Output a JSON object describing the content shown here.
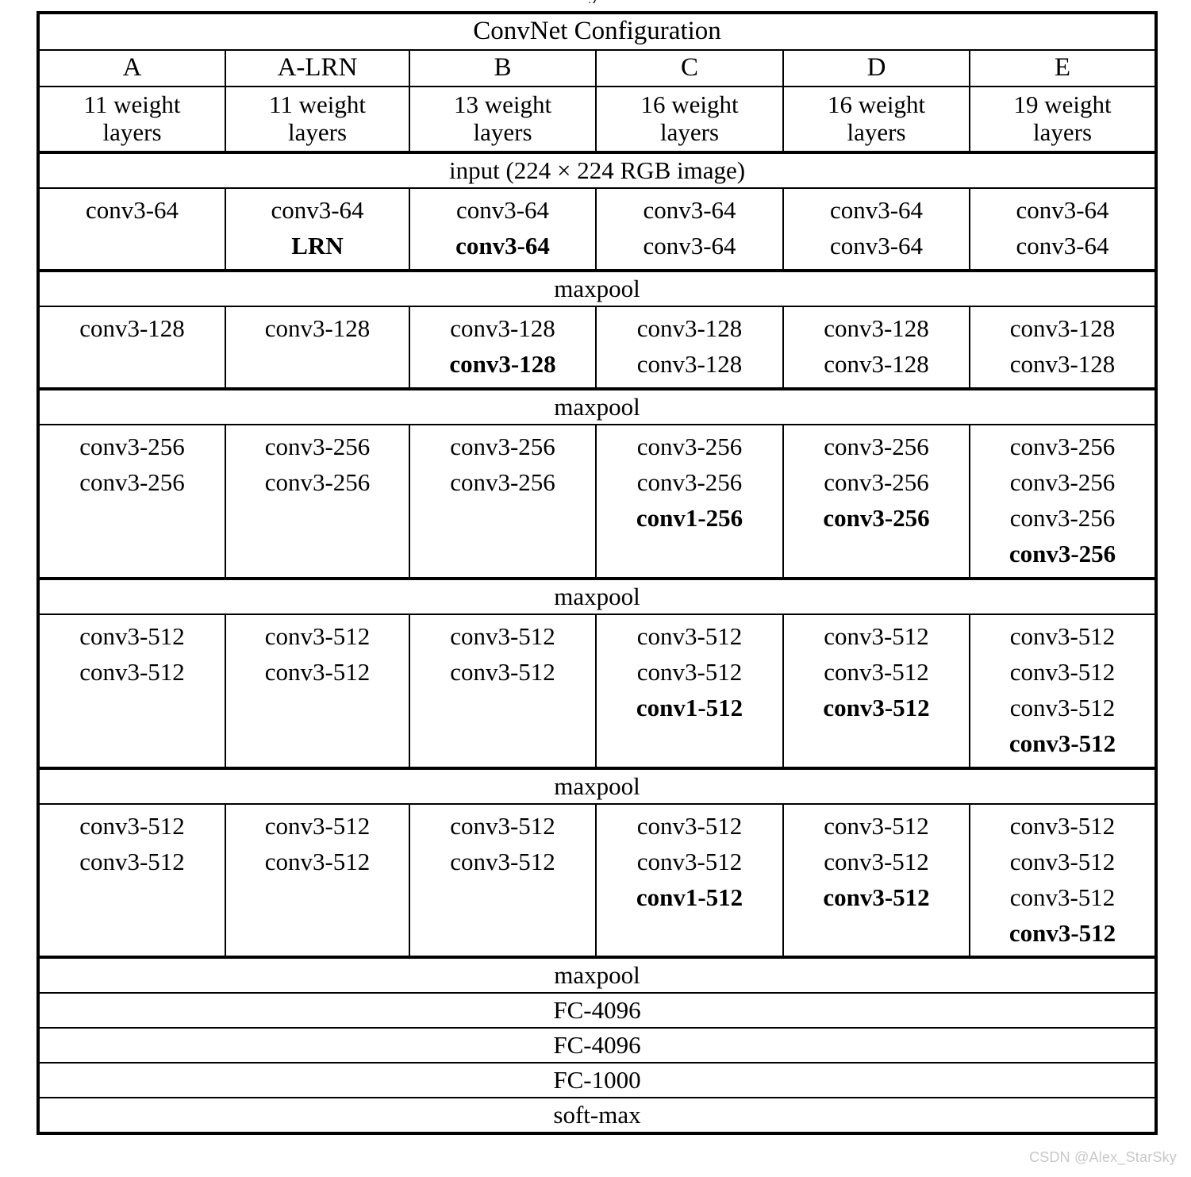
{
  "artifact": {
    "glyph": "y"
  },
  "table": {
    "title": "ConvNet Configuration",
    "columns": [
      {
        "name": "A",
        "weights_line1": "11 weight",
        "weights_line2": "layers"
      },
      {
        "name": "A-LRN",
        "weights_line1": "11 weight",
        "weights_line2": "layers"
      },
      {
        "name": "B",
        "weights_line1": "13 weight",
        "weights_line2": "layers"
      },
      {
        "name": "C",
        "weights_line1": "16 weight",
        "weights_line2": "layers"
      },
      {
        "name": "D",
        "weights_line1": "16 weight",
        "weights_line2": "layers"
      },
      {
        "name": "E",
        "weights_line1": "19 weight",
        "weights_line2": "layers"
      }
    ],
    "input_row": "input (224 × 224 RGB image)",
    "maxpool_label": "maxpool",
    "blocks": {
      "b64": {
        "A": [
          {
            "t": "conv3-64",
            "bold": false
          }
        ],
        "A-LRN": [
          {
            "t": "conv3-64",
            "bold": false
          },
          {
            "t": "LRN",
            "bold": true
          }
        ],
        "B": [
          {
            "t": "conv3-64",
            "bold": false
          },
          {
            "t": "conv3-64",
            "bold": true
          }
        ],
        "C": [
          {
            "t": "conv3-64",
            "bold": false
          },
          {
            "t": "conv3-64",
            "bold": false
          }
        ],
        "D": [
          {
            "t": "conv3-64",
            "bold": false
          },
          {
            "t": "conv3-64",
            "bold": false
          }
        ],
        "E": [
          {
            "t": "conv3-64",
            "bold": false
          },
          {
            "t": "conv3-64",
            "bold": false
          }
        ]
      },
      "b128": {
        "A": [
          {
            "t": "conv3-128",
            "bold": false
          }
        ],
        "A-LRN": [
          {
            "t": "conv3-128",
            "bold": false
          }
        ],
        "B": [
          {
            "t": "conv3-128",
            "bold": false
          },
          {
            "t": "conv3-128",
            "bold": true
          }
        ],
        "C": [
          {
            "t": "conv3-128",
            "bold": false
          },
          {
            "t": "conv3-128",
            "bold": false
          }
        ],
        "D": [
          {
            "t": "conv3-128",
            "bold": false
          },
          {
            "t": "conv3-128",
            "bold": false
          }
        ],
        "E": [
          {
            "t": "conv3-128",
            "bold": false
          },
          {
            "t": "conv3-128",
            "bold": false
          }
        ]
      },
      "b256": {
        "A": [
          {
            "t": "conv3-256",
            "bold": false
          },
          {
            "t": "conv3-256",
            "bold": false
          }
        ],
        "A-LRN": [
          {
            "t": "conv3-256",
            "bold": false
          },
          {
            "t": "conv3-256",
            "bold": false
          }
        ],
        "B": [
          {
            "t": "conv3-256",
            "bold": false
          },
          {
            "t": "conv3-256",
            "bold": false
          }
        ],
        "C": [
          {
            "t": "conv3-256",
            "bold": false
          },
          {
            "t": "conv3-256",
            "bold": false
          },
          {
            "t": "conv1-256",
            "bold": true
          }
        ],
        "D": [
          {
            "t": "conv3-256",
            "bold": false
          },
          {
            "t": "conv3-256",
            "bold": false
          },
          {
            "t": "conv3-256",
            "bold": true
          }
        ],
        "E": [
          {
            "t": "conv3-256",
            "bold": false
          },
          {
            "t": "conv3-256",
            "bold": false
          },
          {
            "t": "conv3-256",
            "bold": false
          },
          {
            "t": "conv3-256",
            "bold": true
          }
        ]
      },
      "b512a": {
        "A": [
          {
            "t": "conv3-512",
            "bold": false
          },
          {
            "t": "conv3-512",
            "bold": false
          }
        ],
        "A-LRN": [
          {
            "t": "conv3-512",
            "bold": false
          },
          {
            "t": "conv3-512",
            "bold": false
          }
        ],
        "B": [
          {
            "t": "conv3-512",
            "bold": false
          },
          {
            "t": "conv3-512",
            "bold": false
          }
        ],
        "C": [
          {
            "t": "conv3-512",
            "bold": false
          },
          {
            "t": "conv3-512",
            "bold": false
          },
          {
            "t": "conv1-512",
            "bold": true
          }
        ],
        "D": [
          {
            "t": "conv3-512",
            "bold": false
          },
          {
            "t": "conv3-512",
            "bold": false
          },
          {
            "t": "conv3-512",
            "bold": true
          }
        ],
        "E": [
          {
            "t": "conv3-512",
            "bold": false
          },
          {
            "t": "conv3-512",
            "bold": false
          },
          {
            "t": "conv3-512",
            "bold": false
          },
          {
            "t": "conv3-512",
            "bold": true
          }
        ]
      },
      "b512b": {
        "A": [
          {
            "t": "conv3-512",
            "bold": false
          },
          {
            "t": "conv3-512",
            "bold": false
          }
        ],
        "A-LRN": [
          {
            "t": "conv3-512",
            "bold": false
          },
          {
            "t": "conv3-512",
            "bold": false
          }
        ],
        "B": [
          {
            "t": "conv3-512",
            "bold": false
          },
          {
            "t": "conv3-512",
            "bold": false
          }
        ],
        "C": [
          {
            "t": "conv3-512",
            "bold": false
          },
          {
            "t": "conv3-512",
            "bold": false
          },
          {
            "t": "conv1-512",
            "bold": true
          }
        ],
        "D": [
          {
            "t": "conv3-512",
            "bold": false
          },
          {
            "t": "conv3-512",
            "bold": false
          },
          {
            "t": "conv3-512",
            "bold": true
          }
        ],
        "E": [
          {
            "t": "conv3-512",
            "bold": false
          },
          {
            "t": "conv3-512",
            "bold": false
          },
          {
            "t": "conv3-512",
            "bold": false
          },
          {
            "t": "conv3-512",
            "bold": true
          }
        ]
      }
    },
    "tail_rows": [
      "FC-4096",
      "FC-4096",
      "FC-1000",
      "soft-max"
    ]
  },
  "watermark": {
    "text": "CSDN @Alex_StarSky"
  }
}
